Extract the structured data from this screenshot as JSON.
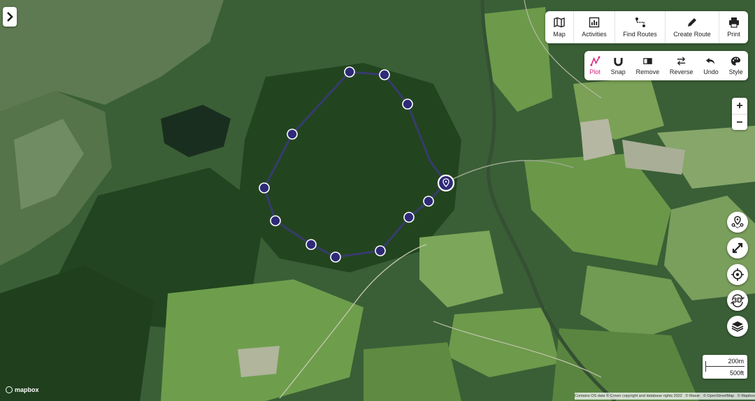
{
  "toolbar": {
    "items": [
      {
        "label": "Map",
        "icon": "map-icon"
      },
      {
        "label": "Activities",
        "icon": "bar-chart-icon"
      },
      {
        "label": "Find Routes",
        "icon": "route-icon"
      },
      {
        "label": "Create Route",
        "icon": "pencil-icon"
      },
      {
        "label": "Print",
        "icon": "printer-icon"
      }
    ]
  },
  "plot_toolbar": {
    "items": [
      {
        "label": "Plot",
        "icon": "plot-line-icon",
        "active": true
      },
      {
        "label": "Snap",
        "icon": "magnet-icon",
        "active": false
      },
      {
        "label": "Remove",
        "icon": "eraser-icon",
        "active": false
      },
      {
        "label": "Reverse",
        "icon": "reverse-arrows-icon",
        "active": false
      },
      {
        "label": "Undo",
        "icon": "undo-icon",
        "active": false
      },
      {
        "label": "Style",
        "icon": "palette-icon",
        "active": false
      }
    ],
    "active_color": "#d6227a"
  },
  "zoom": {
    "in": "+",
    "out": "−"
  },
  "side_controls": {
    "three_d": "3D"
  },
  "scale": {
    "metric": "200m",
    "imperial": "500ft"
  },
  "brand": "mapbox",
  "attribution": [
    "Contains OS data © Crown copyright and database rights 2022",
    "© Maxar",
    "© OpenStreetMap",
    "© Mapbox"
  ],
  "route": {
    "color": "#3b3a7a",
    "waypoint_fill": "#2e2a78",
    "waypoint_count": 12
  }
}
